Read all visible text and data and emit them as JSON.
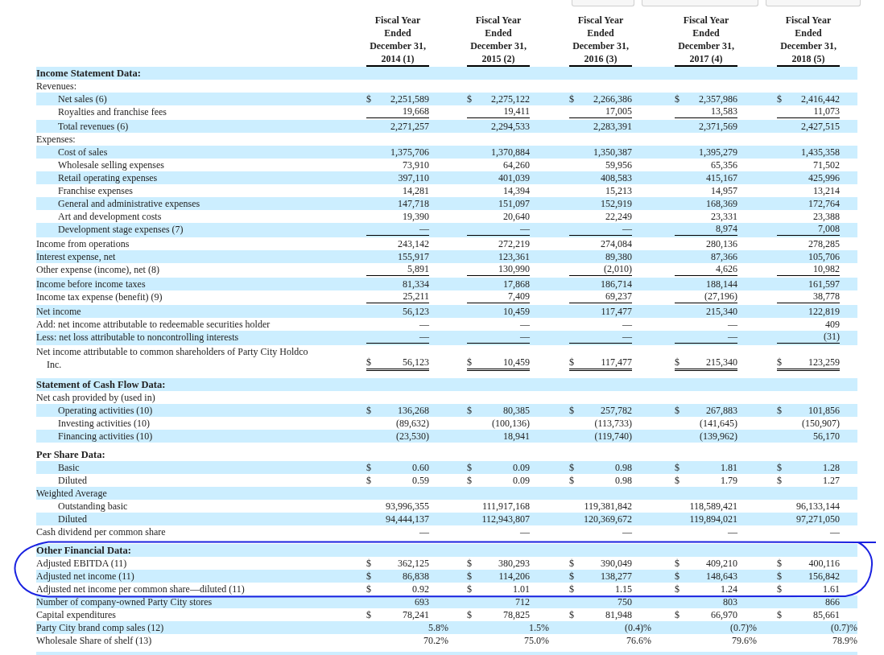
{
  "toolbar_buttons": [
    {
      "kind": "tab"
    },
    {
      "kind": "tab"
    },
    {
      "kind": "tab"
    }
  ],
  "columns": [
    {
      "header": [
        "Fiscal Year",
        "Ended",
        "December 31,",
        "2014 (1)"
      ]
    },
    {
      "header": [
        "Fiscal Year",
        "Ended",
        "December 31,",
        "2015 (2)"
      ]
    },
    {
      "header": [
        "Fiscal Year",
        "Ended",
        "December 31,",
        "2016 (3)"
      ]
    },
    {
      "header": [
        "Fiscal Year",
        "Ended",
        "December 31,",
        "2017 (4)"
      ]
    },
    {
      "header": [
        "Fiscal Year",
        "Ended",
        "December 31,",
        "2018 (5)"
      ]
    }
  ],
  "rows": [
    {
      "kind": "section",
      "label": "Income Statement Data:"
    },
    {
      "kind": "group",
      "label": "Revenues:"
    },
    {
      "kind": "item",
      "label": "Net sales (6)",
      "cells": [
        {
          "currency": "$",
          "value": "2,251,589"
        },
        {
          "currency": "$",
          "value": "2,275,122"
        },
        {
          "currency": "$",
          "value": "2,266,386"
        },
        {
          "currency": "$",
          "value": "2,357,986"
        },
        {
          "currency": "$",
          "value": "2,416,442"
        }
      ]
    },
    {
      "kind": "item",
      "label": "Royalties and franchise fees",
      "rule": true,
      "cells": [
        {
          "value": "19,668"
        },
        {
          "value": "19,411"
        },
        {
          "value": "17,005"
        },
        {
          "value": "13,583"
        },
        {
          "value": "11,073"
        }
      ]
    },
    {
      "kind": "item",
      "label": "Total revenues (6)",
      "cells": [
        {
          "value": "2,271,257"
        },
        {
          "value": "2,294,533"
        },
        {
          "value": "2,283,391"
        },
        {
          "value": "2,371,569"
        },
        {
          "value": "2,427,515"
        }
      ]
    },
    {
      "kind": "group",
      "label": "Expenses:"
    },
    {
      "kind": "item",
      "label": "Cost of sales",
      "cells": [
        {
          "value": "1,375,706"
        },
        {
          "value": "1,370,884"
        },
        {
          "value": "1,350,387"
        },
        {
          "value": "1,395,279"
        },
        {
          "value": "1,435,358"
        }
      ]
    },
    {
      "kind": "item",
      "label": "Wholesale selling expenses",
      "cells": [
        {
          "value": "73,910"
        },
        {
          "value": "64,260"
        },
        {
          "value": "59,956"
        },
        {
          "value": "65,356"
        },
        {
          "value": "71,502"
        }
      ]
    },
    {
      "kind": "item",
      "label": "Retail operating expenses",
      "cells": [
        {
          "value": "397,110"
        },
        {
          "value": "401,039"
        },
        {
          "value": "408,583"
        },
        {
          "value": "415,167"
        },
        {
          "value": "425,996"
        }
      ]
    },
    {
      "kind": "item",
      "label": "Franchise expenses",
      "cells": [
        {
          "value": "14,281"
        },
        {
          "value": "14,394"
        },
        {
          "value": "15,213"
        },
        {
          "value": "14,957"
        },
        {
          "value": "13,214"
        }
      ]
    },
    {
      "kind": "item",
      "label": "General and administrative expenses",
      "cells": [
        {
          "value": "147,718"
        },
        {
          "value": "151,097"
        },
        {
          "value": "152,919"
        },
        {
          "value": "168,369"
        },
        {
          "value": "172,764"
        }
      ]
    },
    {
      "kind": "item",
      "label": "Art and development costs",
      "cells": [
        {
          "value": "19,390"
        },
        {
          "value": "20,640"
        },
        {
          "value": "22,249"
        },
        {
          "value": "23,331"
        },
        {
          "value": "23,388"
        }
      ]
    },
    {
      "kind": "item",
      "label": "Development stage expenses (7)",
      "rule": true,
      "cells": [
        {
          "value": "—"
        },
        {
          "value": "—"
        },
        {
          "value": "—"
        },
        {
          "value": "8,974"
        },
        {
          "value": "7,008"
        }
      ]
    },
    {
      "kind": "line",
      "label": "Income from operations",
      "cells": [
        {
          "value": "243,142"
        },
        {
          "value": "272,219"
        },
        {
          "value": "274,084"
        },
        {
          "value": "280,136"
        },
        {
          "value": "278,285"
        }
      ]
    },
    {
      "kind": "line",
      "label": "Interest expense, net",
      "cells": [
        {
          "value": "155,917"
        },
        {
          "value": "123,361"
        },
        {
          "value": "89,380"
        },
        {
          "value": "87,366"
        },
        {
          "value": "105,706"
        }
      ]
    },
    {
      "kind": "line",
      "label": "Other expense (income), net (8)",
      "rule": true,
      "cells": [
        {
          "value": "5,891"
        },
        {
          "value": "130,990"
        },
        {
          "value": "(2,010)"
        },
        {
          "value": "4,626"
        },
        {
          "value": "10,982"
        }
      ]
    },
    {
      "kind": "line",
      "label": "Income before income taxes",
      "cells": [
        {
          "value": "81,334"
        },
        {
          "value": "17,868"
        },
        {
          "value": "186,714"
        },
        {
          "value": "188,144"
        },
        {
          "value": "161,597"
        }
      ]
    },
    {
      "kind": "line",
      "label": "Income tax expense (benefit) (9)",
      "rule": true,
      "cells": [
        {
          "value": "25,211"
        },
        {
          "value": "7,409"
        },
        {
          "value": "69,237"
        },
        {
          "value": "(27,196)"
        },
        {
          "value": "38,778"
        }
      ]
    },
    {
      "kind": "line",
      "label": "Net income",
      "cells": [
        {
          "value": "56,123"
        },
        {
          "value": "10,459"
        },
        {
          "value": "117,477"
        },
        {
          "value": "215,340"
        },
        {
          "value": "122,819"
        }
      ]
    },
    {
      "kind": "line",
      "label": "Add: net income attributable to redeemable securities holder",
      "cells": [
        {
          "value": "—"
        },
        {
          "value": "—"
        },
        {
          "value": "—"
        },
        {
          "value": "—"
        },
        {
          "value": "409"
        }
      ]
    },
    {
      "kind": "line",
      "label": "Less: net loss attributable to noncontrolling interests",
      "rule": true,
      "cells": [
        {
          "value": "—"
        },
        {
          "value": "—"
        },
        {
          "value": "—"
        },
        {
          "value": "—"
        },
        {
          "value": "(31)"
        }
      ]
    },
    {
      "kind": "line",
      "label": "Net income attributable to common shareholders of Party City Holdco Inc.",
      "double_rule": true,
      "cells": [
        {
          "currency": "$",
          "value": "56,123"
        },
        {
          "currency": "$",
          "value": "10,459"
        },
        {
          "currency": "$",
          "value": "117,477"
        },
        {
          "currency": "$",
          "value": "215,340"
        },
        {
          "currency": "$",
          "value": "123,259"
        }
      ]
    },
    {
      "kind": "section",
      "label": "Statement of Cash Flow Data:"
    },
    {
      "kind": "group",
      "label": "Net cash provided by (used in)"
    },
    {
      "kind": "item",
      "label": "Operating activities (10)",
      "cells": [
        {
          "currency": "$",
          "value": "136,268"
        },
        {
          "currency": "$",
          "value": "80,385"
        },
        {
          "currency": "$",
          "value": "257,782"
        },
        {
          "currency": "$",
          "value": "267,883"
        },
        {
          "currency": "$",
          "value": "101,856"
        }
      ]
    },
    {
      "kind": "item",
      "label": "Investing activities (10)",
      "cells": [
        {
          "value": "(89,632)"
        },
        {
          "value": "(100,136)"
        },
        {
          "value": "(113,733)"
        },
        {
          "value": "(141,645)"
        },
        {
          "value": "(150,907)"
        }
      ]
    },
    {
      "kind": "item",
      "label": "Financing activities (10)",
      "cells": [
        {
          "value": "(23,530)"
        },
        {
          "value": "18,941"
        },
        {
          "value": "(119,740)"
        },
        {
          "value": "(139,962)"
        },
        {
          "value": "56,170"
        }
      ]
    },
    {
      "kind": "section",
      "label": "Per Share Data:"
    },
    {
      "kind": "item",
      "label": "Basic",
      "cells": [
        {
          "currency": "$",
          "value": "0.60"
        },
        {
          "currency": "$",
          "value": "0.09"
        },
        {
          "currency": "$",
          "value": "0.98"
        },
        {
          "currency": "$",
          "value": "1.81"
        },
        {
          "currency": "$",
          "value": "1.28"
        }
      ]
    },
    {
      "kind": "item",
      "label": "Diluted",
      "cells": [
        {
          "currency": "$",
          "value": "0.59"
        },
        {
          "currency": "$",
          "value": "0.09"
        },
        {
          "currency": "$",
          "value": "0.98"
        },
        {
          "currency": "$",
          "value": "1.79"
        },
        {
          "currency": "$",
          "value": "1.27"
        }
      ]
    },
    {
      "kind": "group",
      "label": "Weighted Average"
    },
    {
      "kind": "item",
      "label": "Outstanding basic",
      "cells": [
        {
          "value": "93,996,355"
        },
        {
          "value": "111,917,168"
        },
        {
          "value": "119,381,842"
        },
        {
          "value": "118,589,421"
        },
        {
          "value": "96,133,144"
        }
      ]
    },
    {
      "kind": "item",
      "label": "Diluted",
      "cells": [
        {
          "value": "94,444,137"
        },
        {
          "value": "112,943,807"
        },
        {
          "value": "120,369,672"
        },
        {
          "value": "119,894,021"
        },
        {
          "value": "97,271,050"
        }
      ]
    },
    {
      "kind": "line",
      "label": "Cash dividend per common share",
      "cells": [
        {
          "value": "—"
        },
        {
          "value": "—"
        },
        {
          "value": "—"
        },
        {
          "value": "—"
        },
        {
          "value": "—"
        }
      ]
    },
    {
      "kind": "section",
      "label": "Other Financial Data:"
    },
    {
      "kind": "line",
      "label": "Adjusted EBITDA (11)",
      "cells": [
        {
          "currency": "$",
          "value": "362,125"
        },
        {
          "currency": "$",
          "value": "380,293"
        },
        {
          "currency": "$",
          "value": "390,049"
        },
        {
          "currency": "$",
          "value": "409,210"
        },
        {
          "currency": "$",
          "value": "400,116"
        }
      ]
    },
    {
      "kind": "line",
      "label": "Adjusted net income (11)",
      "cells": [
        {
          "currency": "$",
          "value": "86,838"
        },
        {
          "currency": "$",
          "value": "114,206"
        },
        {
          "currency": "$",
          "value": "138,277"
        },
        {
          "currency": "$",
          "value": "148,643"
        },
        {
          "currency": "$",
          "value": "156,842"
        }
      ]
    },
    {
      "kind": "line",
      "label": "Adjusted net income per common share—diluted (11)",
      "cells": [
        {
          "currency": "$",
          "value": "0.92"
        },
        {
          "currency": "$",
          "value": "1.01"
        },
        {
          "currency": "$",
          "value": "1.15"
        },
        {
          "currency": "$",
          "value": "1.24"
        },
        {
          "currency": "$",
          "value": "1.61"
        }
      ]
    },
    {
      "kind": "line",
      "label": "Number of company-owned Party City stores",
      "cells": [
        {
          "value": "693"
        },
        {
          "value": "712"
        },
        {
          "value": "750"
        },
        {
          "value": "803"
        },
        {
          "value": "866"
        }
      ]
    },
    {
      "kind": "line",
      "label": "Capital expenditures",
      "cells": [
        {
          "currency": "$",
          "value": "78,241"
        },
        {
          "currency": "$",
          "value": "78,825"
        },
        {
          "currency": "$",
          "value": "81,948"
        },
        {
          "currency": "$",
          "value": "66,970"
        },
        {
          "currency": "$",
          "value": "85,661"
        }
      ]
    },
    {
      "kind": "percent",
      "label": "Party City brand comp sales (12)",
      "cells": [
        {
          "value": "5.8%"
        },
        {
          "value": "1.5%"
        },
        {
          "value": "(0.4)%"
        },
        {
          "value": "(0.7)%"
        },
        {
          "value": "(0.7)%"
        }
      ]
    },
    {
      "kind": "percent",
      "label": "Wholesale Share of shelf (13)",
      "cells": [
        {
          "value": "70.2%"
        },
        {
          "value": "75.0%"
        },
        {
          "value": "76.6%"
        },
        {
          "value": "79.6%"
        },
        {
          "value": "78.9%"
        }
      ]
    }
  ]
}
